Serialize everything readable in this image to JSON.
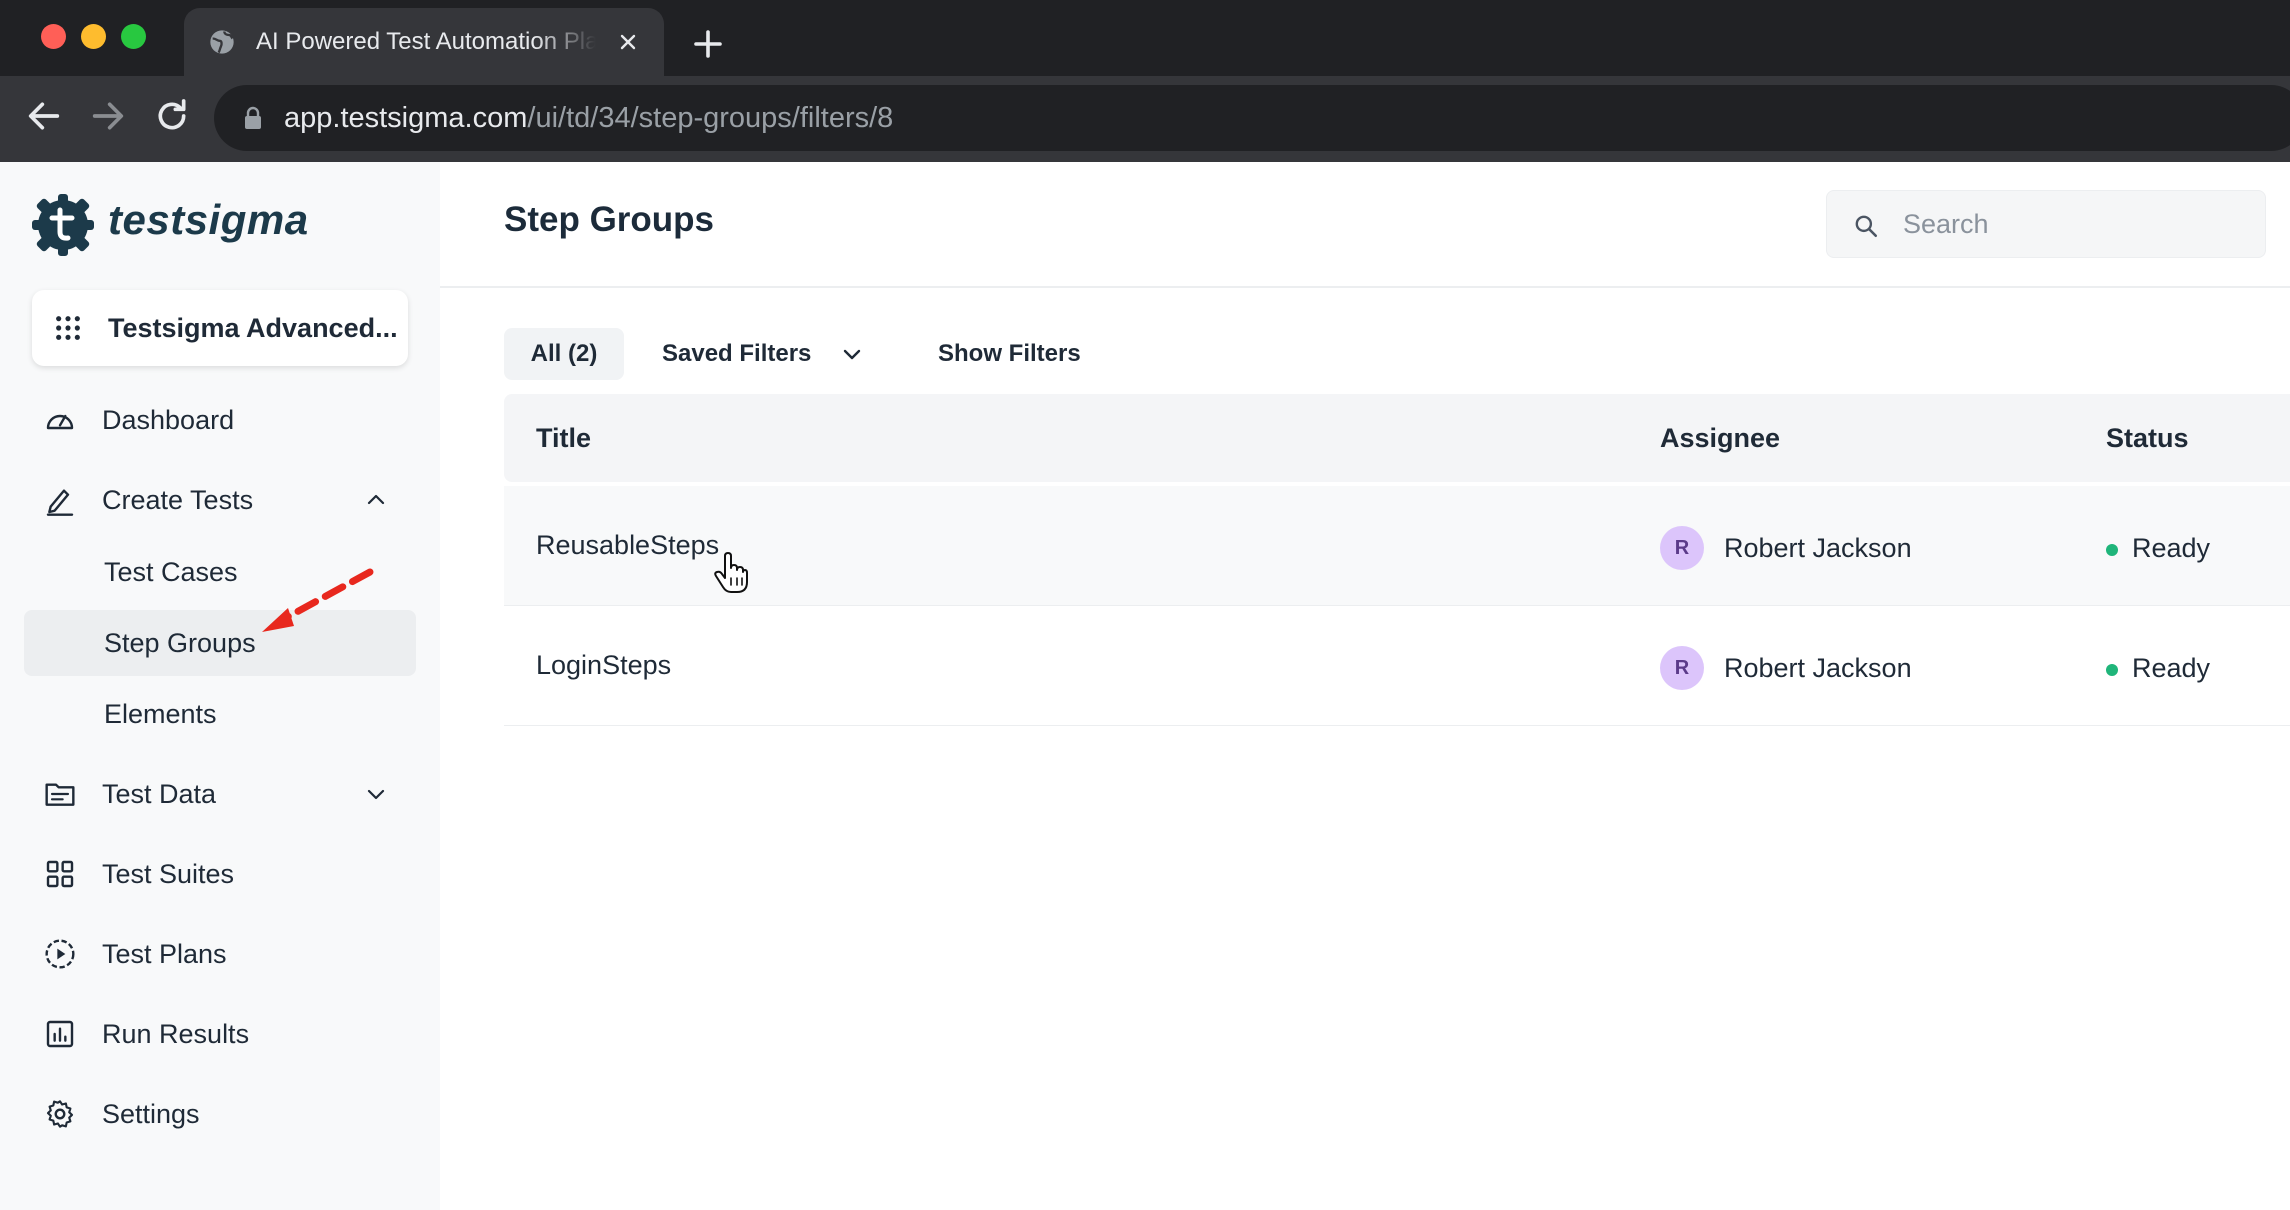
{
  "browser": {
    "tab_title": "AI Powered Test Automation Platform",
    "url_host": "app.testsigma.com",
    "url_path": "/ui/td/34/step-groups/filters/8"
  },
  "sidebar": {
    "logo_text": "testsigma",
    "workspace": "Testsigma Advanced...",
    "items": [
      {
        "label": "Dashboard",
        "icon": "speedometer-icon"
      },
      {
        "label": "Create Tests",
        "icon": "pencil-icon",
        "expanded": true
      },
      {
        "label": "Test Cases"
      },
      {
        "label": "Step Groups",
        "active": true
      },
      {
        "label": "Elements"
      },
      {
        "label": "Test Data",
        "icon": "folder-icon",
        "expanded": false
      },
      {
        "label": "Test Suites",
        "icon": "grid-icon"
      },
      {
        "label": "Test Plans",
        "icon": "play-circle-icon"
      },
      {
        "label": "Run Results",
        "icon": "bar-chart-icon"
      },
      {
        "label": "Settings",
        "icon": "gear-icon"
      }
    ]
  },
  "main": {
    "title": "Step Groups",
    "search_placeholder": "Search",
    "filters": {
      "all": "All (2)",
      "saved": "Saved Filters",
      "show": "Show Filters"
    },
    "table": {
      "columns": [
        "Title",
        "Assignee",
        "Status"
      ],
      "rows": [
        {
          "title": "ReusableSteps",
          "avatar": "R",
          "assignee": "Robert Jackson",
          "status": "Ready"
        },
        {
          "title": "LoginSteps",
          "avatar": "R",
          "assignee": "Robert Jackson",
          "status": "Ready"
        }
      ]
    }
  },
  "colors": {
    "brand": "#1c3a4a",
    "status_ready": "#1fb57a",
    "avatar_bg": "#dcc5fb",
    "annotation_arrow": "#e8281e"
  }
}
